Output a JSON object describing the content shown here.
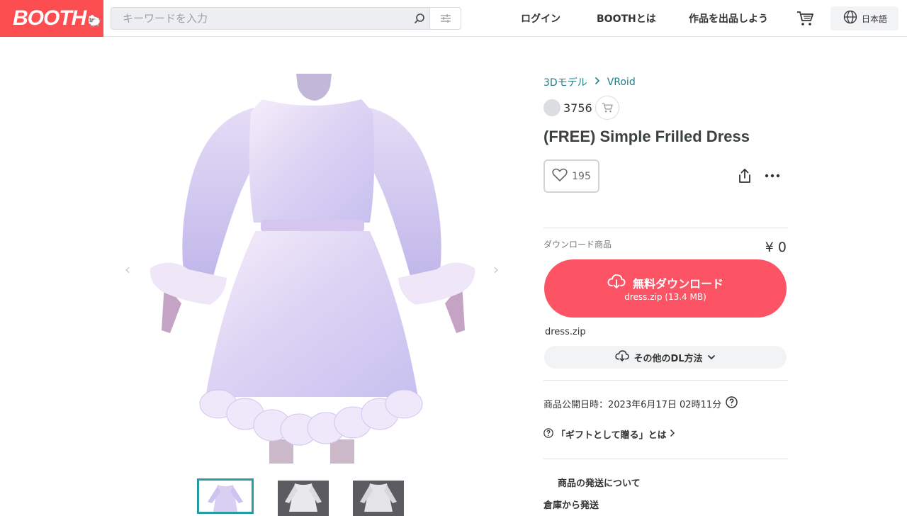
{
  "header": {
    "logo": "BOOTH",
    "search_placeholder": "キーワードを入力",
    "nav": [
      "ログイン",
      "BOOTHとは",
      "作品を出品しよう"
    ],
    "language": "日本語"
  },
  "breadcrumb": [
    "3Dモデル",
    "VRoid"
  ],
  "shop_name": "3756",
  "product": {
    "title": "(FREE) Simple Frilled Dress",
    "like_count": "195",
    "download_label": "ダウンロード商品",
    "price": "¥ 0",
    "download_button": "無料ダウンロード",
    "download_file_info": "dress.zip (13.4 MB)",
    "file_name": "dress.zip",
    "other_dl": "その他のDL方法",
    "published": "商品公開日時：2023年6月17日 02時11分",
    "gift": "「ギフトとして贈る」とは",
    "shipping_heading": "商品の発送について",
    "shipping_from": "倉庫から発送"
  },
  "colors": {
    "brand": "#fc4d50",
    "download": "#fc5465",
    "link": "#1f7e86",
    "thumb_border": "#2a9aa4"
  }
}
